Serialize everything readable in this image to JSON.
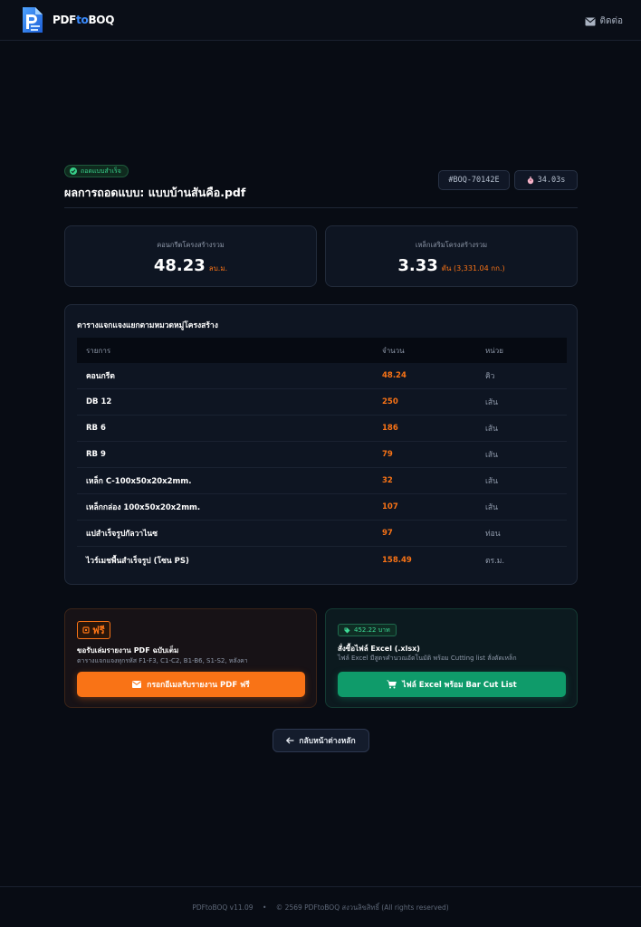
{
  "header": {
    "brand_pre": "PDF",
    "brand_to": "to",
    "brand_post": "BOQ",
    "contact_label": "ติดต่อ"
  },
  "result": {
    "status_badge": "ถอดแบบสำเร็จ",
    "title": "ผลการถอดแบบ: แบบบ้านสันคือ.pdf",
    "job_id": "#BOQ-70142E",
    "duration": "34.03s"
  },
  "stats": {
    "concrete": {
      "label": "คอนกรีตโครงสร้างรวม",
      "value": "48.23",
      "unit": "ลบ.ม."
    },
    "steel": {
      "label": "เหล็กเสริมโครงสร้างรวม",
      "value": "3.33",
      "unit": "ตัน (3,331.04 กก.)"
    }
  },
  "table": {
    "title": "ตารางแจกแจงแยกตามหมวดหมู่โครงสร้าง",
    "headers": [
      "รายการ",
      "จำนวน",
      "หน่วย"
    ],
    "rows": [
      {
        "item": "คอนกรีต",
        "qty": "48.24",
        "unit": "คิว"
      },
      {
        "item": "DB 12",
        "qty": "250",
        "unit": "เส้น"
      },
      {
        "item": "RB 6",
        "qty": "186",
        "unit": "เส้น"
      },
      {
        "item": "RB 9",
        "qty": "79",
        "unit": "เส้น"
      },
      {
        "item": "เหล็ก C-100x50x20x2mm.",
        "qty": "32",
        "unit": "เส้น"
      },
      {
        "item": "เหล็กกล่อง 100x50x20x2mm.",
        "qty": "107",
        "unit": "เส้น"
      },
      {
        "item": "แปสำเร็จรูปกัลวาไนซ",
        "qty": "97",
        "unit": "ท่อน"
      },
      {
        "item": "ไวร์เมชพื้นสำเร็จรูป (โซน PS)",
        "qty": "158.49",
        "unit": "ตร.ม."
      }
    ]
  },
  "free_offer": {
    "tag": "ฟรี",
    "title": "ขอรับเล่มรายงาน PDF ฉบับเต็ม",
    "subtitle": "ตารางแจกแจงทุกรหัส F1-F3, C1-C2, B1-B6, S1-S2, หลังคา",
    "button": "กรอกอีเมลรับรายงาน PDF ฟรี"
  },
  "excel_offer": {
    "price": "452.22 บาท",
    "title": "สั่งซื้อไฟล์ Excel (.xlsx)",
    "subtitle": "ไฟล์ Excel มีสูตรคำนวณอัตโนมัติ พร้อม Cutting list สั่งตัดเหล็ก",
    "button": "ไฟล์ Excel พร้อม Bar Cut List"
  },
  "back_button": "กลับหน้าต่างหลัก",
  "footer": {
    "version": "PDFtoBOQ v11.09",
    "separator": "•",
    "copyright": "© 2569 PDFtoBOQ สงวนลิขสิทธิ์ (All rights reserved)"
  },
  "colors": {
    "background": "#080c14",
    "accent_orange": "#f97316",
    "accent_green": "#0f9b6a",
    "brand_blue": "#3b8cff"
  },
  "icons": [
    "logo-icon",
    "envelope-icon",
    "check-circle-icon",
    "timer-icon",
    "tag-icon",
    "cart-icon",
    "arrow-left-icon"
  ]
}
